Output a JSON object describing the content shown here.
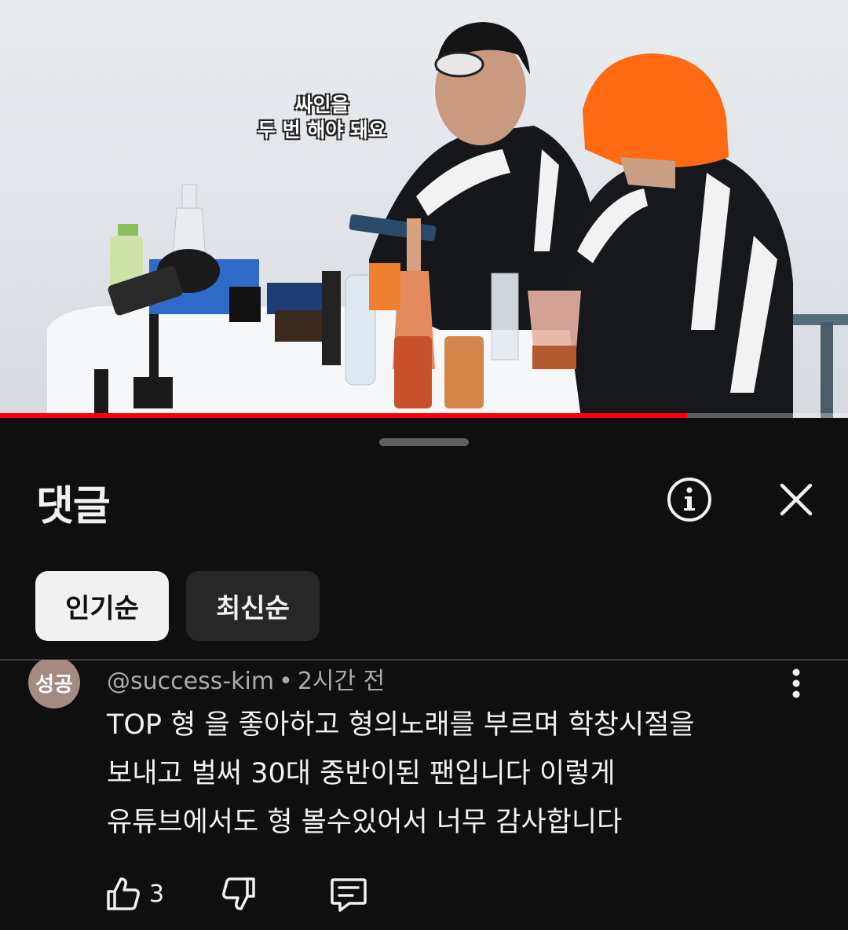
{
  "video": {
    "subtitle_line1": "싸인을",
    "subtitle_line2": "두 번 해야 돼요",
    "progress_fraction": 0.81
  },
  "sheet": {
    "title": "댓글",
    "info_icon": "info-icon",
    "close_icon": "close-icon"
  },
  "sort": {
    "popular_label": "인기순",
    "newest_label": "최신순",
    "selected": "인기순"
  },
  "comment": {
    "avatar_text": "성공",
    "avatar_color": "#a58a7f",
    "author": "@success-kim",
    "time": "2시간 전",
    "body_line1": "TOP 형 을 좋아하고 형의노래를 부르며 학창시절을",
    "body_line2": "보내고 벌써 30대 중반이된 팬입니다 이렇게",
    "body_line3": "유튜브에서도 형 볼수있어서 너무 감사합니다",
    "like_count": "3"
  },
  "colors": {
    "background": "#0f0f0f",
    "chip_selected": "#f1f1f1",
    "chip_unselected": "#272727",
    "secondary_text": "#aaaaaa",
    "progress": "#ff0000"
  }
}
